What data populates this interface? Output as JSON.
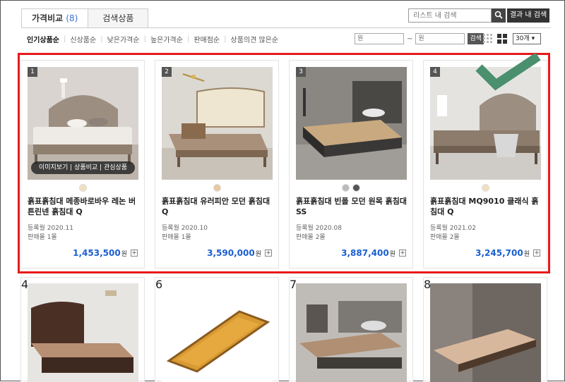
{
  "tabs": [
    {
      "label": "가격비교",
      "count": "(8)"
    },
    {
      "label": "검색상품"
    }
  ],
  "search": {
    "placeholder": "리스트 내 검색",
    "result_button": "결과 내 검색"
  },
  "sort_options": [
    "인기상품순",
    "신상품순",
    "낮은가격순",
    "높은가격순",
    "판매점순",
    "상품의견 많은순"
  ],
  "price_filter": {
    "min_placeholder": "원",
    "max_placeholder": "원",
    "button": "검색"
  },
  "page_size": "30개",
  "overlay_actions": "이미지보기 | 상품비교 | 관심상품",
  "products": [
    {
      "rank": "1",
      "title": "흙표흙침대 메종바로바우 레논 버튼린넨 흙침대 Q",
      "registered": "등록월 2020.11",
      "sellers": "판매몰 1몰",
      "price": "1,453,500",
      "won": "원",
      "colors": [
        "#f2dfc0"
      ]
    },
    {
      "rank": "2",
      "title": "흙표흙침대 유러피안 모던 흙침대 Q",
      "registered": "등록월 2020.10",
      "sellers": "판매몰 1몰",
      "price": "3,590,000",
      "won": "원",
      "colors": [
        "#e6c9a0"
      ]
    },
    {
      "rank": "3",
      "title": "흙표흙침대 빈폴 모던 원목 흙침대 SS",
      "registered": "등록월 2020.08",
      "sellers": "판매몰 2몰",
      "price": "3,887,400",
      "won": "원",
      "colors": [
        "#bbbbbb",
        "#555555"
      ]
    },
    {
      "rank": "4",
      "title": "흙표흙침대 MQ9010 클래식 흙침대 Q",
      "registered": "등록월 2021.02",
      "sellers": "판매몰 2몰",
      "price": "3,245,700",
      "won": "원",
      "colors": [
        "#f2dfc0"
      ]
    }
  ],
  "row2_ranks": [
    "4",
    "6",
    "7",
    "8"
  ],
  "colors": {
    "accent_blue": "#1a5fd1",
    "highlight_red": "#e61a1a",
    "check_green": "#4a8f6e"
  }
}
